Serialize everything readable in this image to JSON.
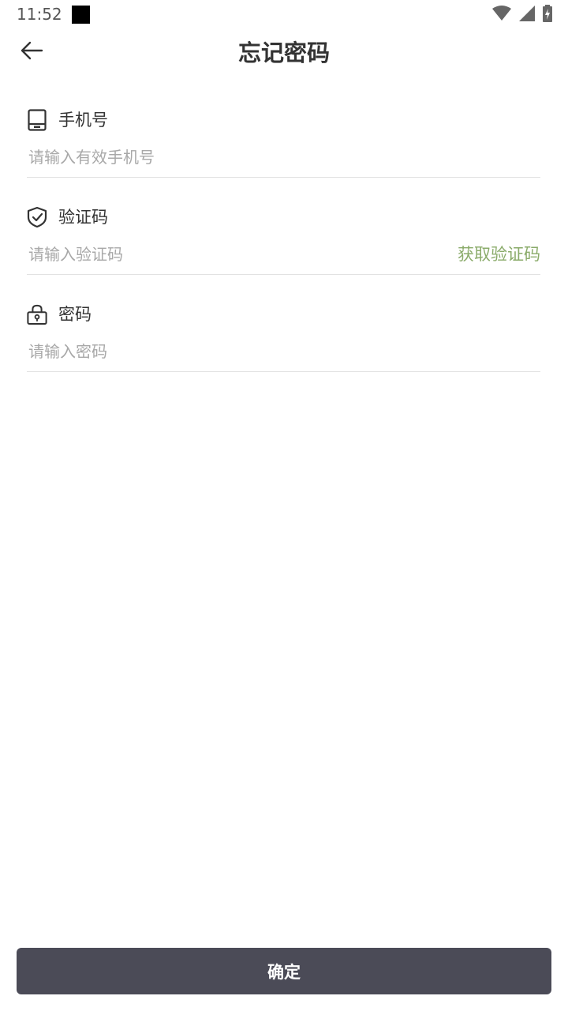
{
  "status_bar": {
    "time": "11:52",
    "icons": [
      "wifi-icon",
      "signal-icon",
      "battery-charging-icon"
    ]
  },
  "header": {
    "title": "忘记密码",
    "back_icon": "arrow-left-icon"
  },
  "form": {
    "phone": {
      "label": "手机号",
      "placeholder": "请输入有效手机号",
      "value": "",
      "icon": "phone-icon"
    },
    "code": {
      "label": "验证码",
      "placeholder": "请输入验证码",
      "value": "",
      "icon": "shield-check-icon",
      "get_code_label": "获取验证码"
    },
    "password": {
      "label": "密码",
      "placeholder": "请输入密码",
      "value": "",
      "icon": "lock-icon"
    }
  },
  "actions": {
    "confirm_label": "确定"
  },
  "colors": {
    "accent_green": "#8aab6a",
    "button_bg": "#4b4b57",
    "divider": "#e2e2e2",
    "placeholder": "#a8a8a8"
  }
}
